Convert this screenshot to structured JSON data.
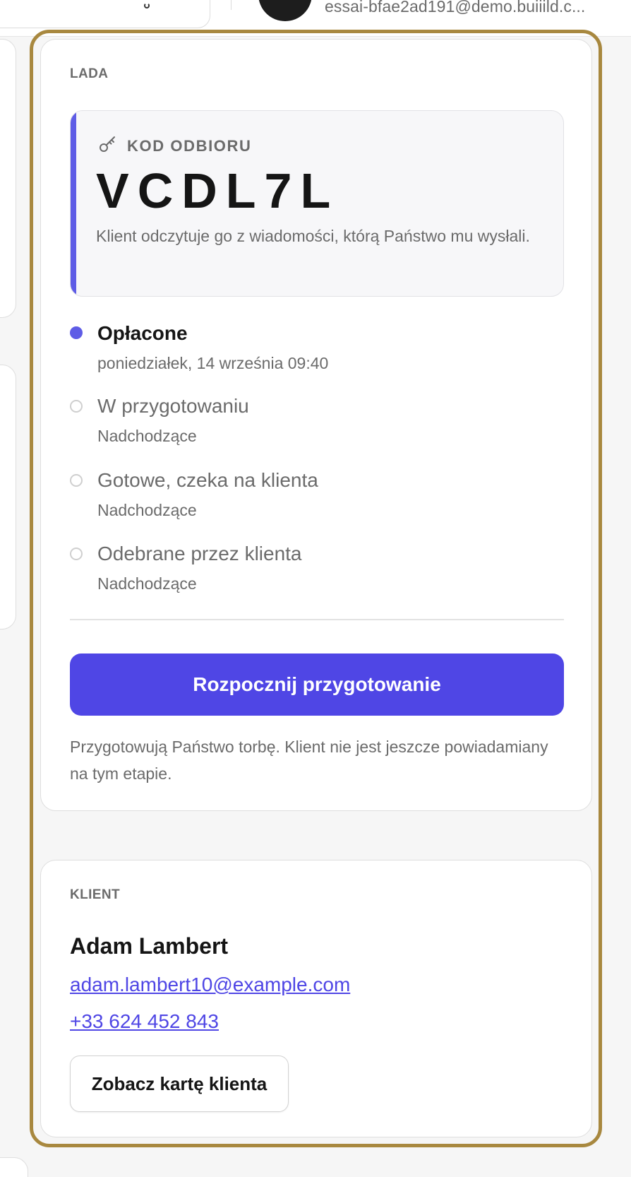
{
  "header": {
    "account_email": "essai-bfae2ad191@demo.buiiild.c..."
  },
  "counter_card": {
    "section_label": "LADA",
    "pickup_code": {
      "label": "KOD ODBIORU",
      "value": "VCDL7L",
      "hint": "Klient odczytuje go z wiadomości, którą Państwo mu wysłali.",
      "icon": "key-icon"
    },
    "timeline": [
      {
        "title": "Opłacone",
        "subtitle": "poniedziałek, 14 września 09:40",
        "state": "done"
      },
      {
        "title": "W przygotowaniu",
        "subtitle": "Nadchodzące",
        "state": "pending"
      },
      {
        "title": "Gotowe, czeka na klienta",
        "subtitle": "Nadchodzące",
        "state": "pending"
      },
      {
        "title": "Odebrane przez klienta",
        "subtitle": "Nadchodzące",
        "state": "pending"
      }
    ],
    "primary_action": "Rozpocznij przygotowanie",
    "note": "Przygotowują Państwo torbę. Klient nie jest jeszcze powiadamiany na tym etapie."
  },
  "client_card": {
    "section_label": "KLIENT",
    "name": "Adam Lambert",
    "email": "adam.lambert10@example.com",
    "phone": "+33 624 452 843",
    "view_button": "Zobacz kartę klienta"
  },
  "colors": {
    "accent": "#4f46e5",
    "timeline_done": "#5e5ce6",
    "highlight_frame": "#a8883f"
  }
}
